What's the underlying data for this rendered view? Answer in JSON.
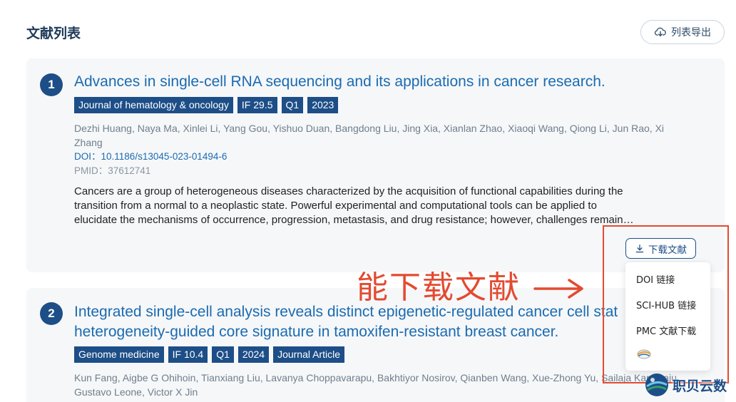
{
  "page": {
    "title": "文献列表",
    "export_label": "列表导出"
  },
  "articles": [
    {
      "index": "1",
      "title": "Advances in single-cell RNA sequencing and its applications in cancer research.",
      "tags": [
        "Journal of hematology & oncology",
        "IF 29.5",
        "Q1",
        "2023"
      ],
      "authors": "Dezhi Huang, Naya Ma, Xinlei Li, Yang Gou, Yishuo Duan, Bangdong Liu, Jing Xia, Xianlan Zhao, Xiaoqi Wang, Qiong Li, Jun Rao, Xi Zhang",
      "doi_label": "DOI：",
      "doi": "10.1186/s13045-023-01494-6",
      "pmid_label": "PMID：",
      "pmid": "37612741",
      "abstract_lines": [
        "Cancers are a group of heterogeneous diseases characterized by the acquisition of functional capabilities during the",
        "transition from a normal to a neoplastic state. Powerful experimental and computational tools can be applied to",
        "elucidate the mechanisms of occurrence, progression, metastasis, and drug resistance; however, challenges remain…"
      ],
      "download_label": "下载文献"
    },
    {
      "index": "2",
      "title_lines": [
        "Integrated single-cell analysis reveals distinct epigenetic-regulated cancer cell stat",
        "heterogeneity-guided core signature in tamoxifen-resistant breast cancer."
      ],
      "tags": [
        "Genome medicine",
        "IF 10.4",
        "Q1",
        "2024",
        "Journal Article"
      ],
      "authors_lines": [
        "Kun Fang, Aigbe G Ohihoin, Tianxiang Liu, Lavanya Choppavarapu, Bakhtiyor Nosirov, Qianben Wang, Xue-Zhong Yu, Sailaja Kamaraju,",
        "Gustavo Leone, Victor X Jin"
      ]
    }
  ],
  "download_menu": {
    "items": [
      "DOI 链接",
      "SCI-HUB 链接",
      "PMC 文献下载"
    ],
    "extra_icon": "pmc-logo-icon"
  },
  "annotation": {
    "text": "能下载文献",
    "arrow": "→",
    "color": "#e34a31"
  },
  "watermark": {
    "text": "职贝云数"
  },
  "colors": {
    "accent": "#1d4e87",
    "link": "#1a6bb1",
    "card_bg": "#f6f7f9",
    "annotation": "#e34a31"
  }
}
